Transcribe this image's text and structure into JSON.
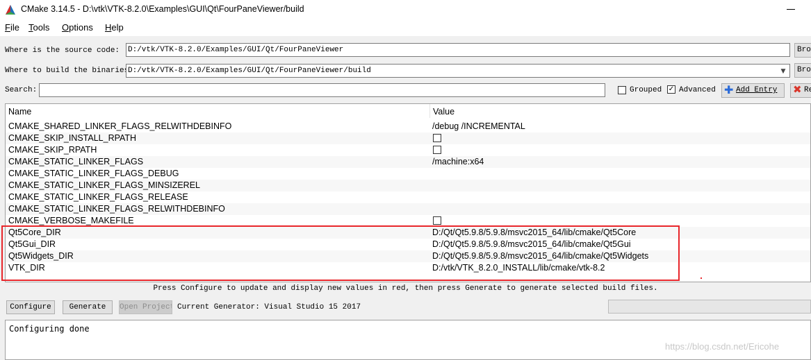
{
  "window": {
    "title": "CMake 3.14.5 - D:\\vtk\\VTK-8.2.0\\Examples\\GUI\\Qt\\FourPaneViewer/build"
  },
  "menu": [
    "File",
    "Tools",
    "Options",
    "Help"
  ],
  "source": {
    "label": "Where is the source code:",
    "value": "D:/vtk/VTK-8.2.0/Examples/GUI/Qt/FourPaneViewer",
    "browse_label": "Brow"
  },
  "binaries": {
    "label": "Where to build the binaries:",
    "value": "D:/vtk/VTK-8.2.0/Examples/GUI/Qt/FourPaneViewer/build",
    "browse_label": "Brow"
  },
  "search": {
    "label": "Search:",
    "value": "",
    "grouped_label": "Grouped",
    "grouped_checked": false,
    "advanced_label": "Advanced",
    "advanced_checked": true,
    "add_entry_label": "Add Entry",
    "remove_entry_label": "Re"
  },
  "table": {
    "headers": {
      "name": "Name",
      "value": "Value"
    },
    "rows": [
      {
        "name": "CMAKE_SHARED_LINKER_FLAGS_RELWITHDEBINFO",
        "value": "/debug /INCREMENTAL",
        "checkbox": false
      },
      {
        "name": "CMAKE_SKIP_INSTALL_RPATH",
        "value": "",
        "checkbox": true
      },
      {
        "name": "CMAKE_SKIP_RPATH",
        "value": "",
        "checkbox": true
      },
      {
        "name": "CMAKE_STATIC_LINKER_FLAGS",
        "value": "/machine:x64",
        "checkbox": false
      },
      {
        "name": "CMAKE_STATIC_LINKER_FLAGS_DEBUG",
        "value": "",
        "checkbox": false
      },
      {
        "name": "CMAKE_STATIC_LINKER_FLAGS_MINSIZEREL",
        "value": "",
        "checkbox": false
      },
      {
        "name": "CMAKE_STATIC_LINKER_FLAGS_RELEASE",
        "value": "",
        "checkbox": false
      },
      {
        "name": "CMAKE_STATIC_LINKER_FLAGS_RELWITHDEBINFO",
        "value": "",
        "checkbox": false
      },
      {
        "name": "CMAKE_VERBOSE_MAKEFILE",
        "value": "",
        "checkbox": true
      },
      {
        "name": "Qt5Core_DIR",
        "value": "D:/Qt/Qt5.9.8/5.9.8/msvc2015_64/lib/cmake/Qt5Core",
        "checkbox": false
      },
      {
        "name": "Qt5Gui_DIR",
        "value": "D:/Qt/Qt5.9.8/5.9.8/msvc2015_64/lib/cmake/Qt5Gui",
        "checkbox": false
      },
      {
        "name": "Qt5Widgets_DIR",
        "value": "D:/Qt/Qt5.9.8/5.9.8/msvc2015_64/lib/cmake/Qt5Widgets",
        "checkbox": false
      },
      {
        "name": "VTK_DIR",
        "value": "D:/vtk/VTK_8.2.0_INSTALL/lib/cmake/vtk-8.2",
        "checkbox": false
      }
    ]
  },
  "hint": "Press Configure to update and display new values in red, then press Generate to generate selected build files.",
  "actions": {
    "configure": "Configure",
    "generate": "Generate",
    "open_project": "Open Project",
    "generator": "Current Generator: Visual Studio 15 2017"
  },
  "output": "Configuring done",
  "watermark": "https://blog.csdn.net/Ericohe",
  "colors": {
    "highlight": "#e8262b",
    "add_icon": "#2a6ad8",
    "remove_icon": "#d9362b"
  }
}
